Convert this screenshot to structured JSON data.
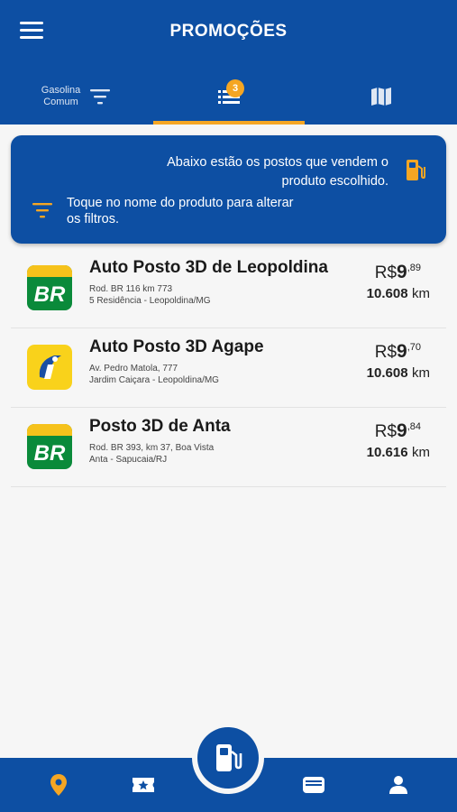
{
  "header": {
    "title": "PROMOÇÕES",
    "tabs": {
      "filter_label_line1": "Gasolina",
      "filter_label_line2": "Comum",
      "list_badge": "3"
    }
  },
  "info_card": {
    "top_text": "Abaixo estão os postos que vendem o produto escolhido.",
    "bottom_text": "Toque no nome do produto para alterar os filtros."
  },
  "stations": [
    {
      "name": "Auto Posto 3D de Leopoldina",
      "address_line1": "Rod. BR 116 km 773",
      "address_line2": "5 Residência - Leopoldina/MG",
      "price_currency": "R$",
      "price_int": "9",
      "price_dec": ",89",
      "distance": "10.608",
      "distance_unit": "km",
      "brand": "BR"
    },
    {
      "name": "Auto Posto 3D Agape",
      "address_line1": "Av. Pedro Matola, 777",
      "address_line2": "Jardim Caiçara - Leopoldina/MG",
      "price_currency": "R$",
      "price_int": "9",
      "price_dec": ",70",
      "distance": "10.608",
      "distance_unit": "km",
      "brand": "Ipiranga"
    },
    {
      "name": "Posto 3D de Anta",
      "address_line1": "Rod. BR 393, km 37, Boa Vista",
      "address_line2": "Anta - Sapucaia/RJ",
      "price_currency": "R$",
      "price_int": "9",
      "price_dec": ",84",
      "distance": "10.616",
      "distance_unit": "km",
      "brand": "BR"
    }
  ],
  "logos": {
    "br_text": "BR"
  },
  "bottom_nav": {
    "items": [
      "location-pin-icon",
      "ticket-star-icon",
      "fuel-pump-icon",
      "wallet-card-icon",
      "user-icon"
    ]
  },
  "colors": {
    "primary": "#0d4fa3",
    "accent": "#f5a623",
    "br_green": "#0a8a3a",
    "br_yellow": "#f6c21b",
    "ipiranga_yellow": "#f9d21b",
    "ipiranga_blue": "#1a4fa3"
  }
}
